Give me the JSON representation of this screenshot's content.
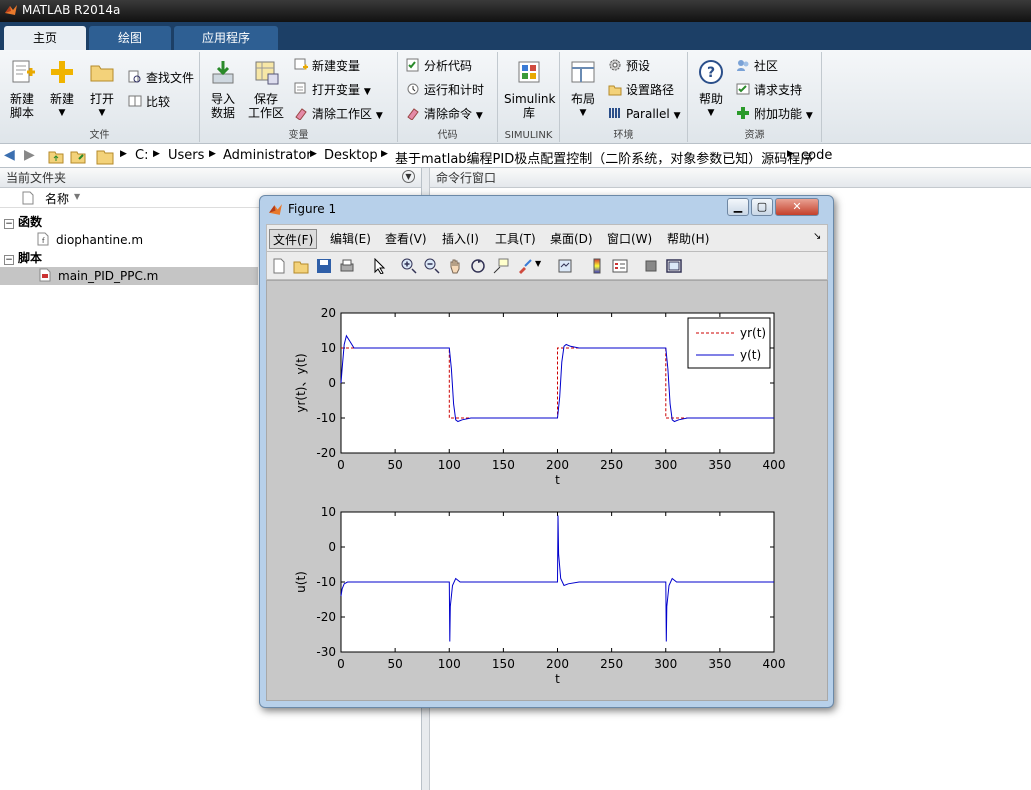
{
  "app_title": "MATLAB R2014a",
  "tabs": [
    "主页",
    "绘图",
    "应用程序"
  ],
  "ribbon": {
    "file": {
      "new_script": "新建",
      "new_script2": "脚本",
      "new": "新建",
      "open": "打开",
      "find_files": "查找文件",
      "compare": "比较",
      "label": "文件"
    },
    "variable": {
      "import": "导入",
      "import2": "数据",
      "save": "保存",
      "save2": "工作区",
      "new_var": "新建变量",
      "open_var": "打开变量",
      "clear_ws": "清除工作区",
      "label": "变量"
    },
    "code": {
      "analyze": "分析代码",
      "run_time": "运行和计时",
      "clear_cmds": "清除命令",
      "label": "代码"
    },
    "simulink": {
      "lib": "Simulink",
      "lib2": "库",
      "label": "SIMULINK"
    },
    "env": {
      "layout": "布局",
      "prefs": "预设",
      "set_path": "设置路径",
      "parallel": "Parallel",
      "label": "环境"
    },
    "resources": {
      "help": "帮助",
      "community": "社区",
      "support": "请求支持",
      "addons": "附加功能",
      "label": "资源"
    }
  },
  "address": [
    "C:",
    "Users",
    "Administrator",
    "Desktop",
    "基于matlab编程PID极点配置控制（二阶系统，对象参数已知）源码程序",
    "code"
  ],
  "current_folder": {
    "title": "当前文件夹",
    "col_name": "名称",
    "groups": [
      {
        "label": "函数",
        "files": [
          "diophantine.m"
        ]
      },
      {
        "label": "脚本",
        "files": [
          "main_PID_PPC.m"
        ]
      }
    ]
  },
  "command_window": {
    "title": "命令行窗口"
  },
  "figure": {
    "title": "Figure 1",
    "menus": [
      "文件(F)",
      "编辑(E)",
      "查看(V)",
      "插入(I)",
      "工具(T)",
      "桌面(D)",
      "窗口(W)",
      "帮助(H)"
    ]
  },
  "colors": {
    "ref": "#cc0000",
    "output": "#0000cc",
    "tab_bg": "#1c3f66"
  },
  "chart_data": [
    {
      "type": "line",
      "xlabel": "t",
      "ylabel": "yr(t)、y(t)",
      "xlim": [
        0,
        400
      ],
      "ylim": [
        -20,
        20
      ],
      "xticks": [
        0,
        50,
        100,
        150,
        200,
        250,
        300,
        350,
        400
      ],
      "yticks": [
        -20,
        -10,
        0,
        10,
        20
      ],
      "legend": {
        "position": "top-right",
        "entries": [
          "yr(t)",
          "y(t)"
        ]
      },
      "series": [
        {
          "name": "yr(t)",
          "style": "dashed",
          "color": "#cc0000",
          "x": [
            0,
            100,
            100,
            200,
            200,
            300,
            300,
            400
          ],
          "y": [
            10,
            10,
            -10,
            -10,
            10,
            10,
            -10,
            -10
          ]
        },
        {
          "name": "y(t)",
          "style": "solid",
          "color": "#0000cc",
          "x": [
            0,
            1,
            3,
            5,
            8,
            12,
            20,
            100,
            102,
            104,
            106,
            108,
            112,
            120,
            200,
            202,
            204,
            206,
            208,
            212,
            220,
            300,
            302,
            304,
            306,
            308,
            312,
            320,
            400
          ],
          "y": [
            0,
            4,
            11,
            13.5,
            12,
            10,
            10,
            10,
            4,
            -6,
            -10.5,
            -11,
            -10.5,
            -10,
            -10,
            -4,
            6,
            10.5,
            11,
            10.5,
            10,
            10,
            4,
            -6,
            -10.5,
            -11,
            -10.5,
            -10,
            -10
          ]
        }
      ]
    },
    {
      "type": "line",
      "xlabel": "t",
      "ylabel": "u(t)",
      "xlim": [
        0,
        400
      ],
      "ylim": [
        -30,
        10
      ],
      "xticks": [
        0,
        50,
        100,
        150,
        200,
        250,
        300,
        350,
        400
      ],
      "yticks": [
        -30,
        -20,
        -10,
        0,
        10
      ],
      "series": [
        {
          "name": "u(t)",
          "style": "solid",
          "color": "#0000cc",
          "x": [
            0,
            1,
            3,
            6,
            10,
            20,
            100,
            100.5,
            101,
            103,
            106,
            110,
            120,
            200,
            200.5,
            201,
            203,
            206,
            210,
            220,
            300,
            300.5,
            301,
            303,
            306,
            310,
            320,
            400
          ],
          "y": [
            -14,
            -12,
            -10.5,
            -10,
            -10,
            -10,
            -10,
            -27,
            -17,
            -11,
            -9,
            -10,
            -10,
            -10,
            9,
            -2,
            -9,
            -11,
            -10.5,
            -10,
            -10,
            -27,
            -17,
            -11,
            -9,
            -10,
            -10,
            -10
          ]
        }
      ]
    }
  ]
}
